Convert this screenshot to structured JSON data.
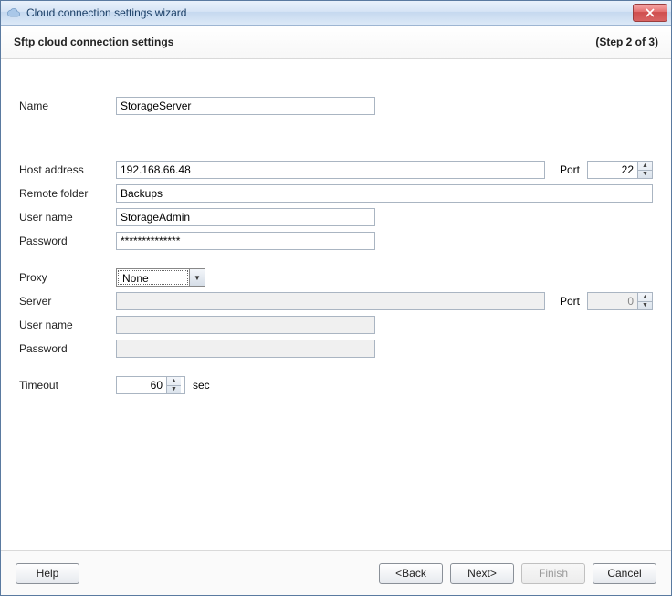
{
  "window": {
    "title": "Cloud connection settings wizard"
  },
  "header": {
    "subtitle": "Sftp cloud connection settings",
    "step": "(Step 2 of 3)"
  },
  "labels": {
    "name": "Name",
    "host": "Host address",
    "remote_folder": "Remote folder",
    "user_name": "User name",
    "password": "Password",
    "proxy": "Proxy",
    "server": "Server",
    "proxy_user": "User name",
    "proxy_password": "Password",
    "timeout": "Timeout",
    "port": "Port",
    "sec": "sec"
  },
  "values": {
    "name": "StorageServer",
    "host": "192.168.66.48",
    "host_port": "22",
    "remote_folder": "Backups",
    "user_name": "StorageAdmin",
    "password": "**************",
    "proxy_selected": "None",
    "proxy_server": "",
    "proxy_port": "0",
    "proxy_user": "",
    "proxy_password": "",
    "timeout": "60"
  },
  "buttons": {
    "help": "Help",
    "back": "<Back",
    "next": "Next>",
    "finish": "Finish",
    "cancel": "Cancel"
  }
}
